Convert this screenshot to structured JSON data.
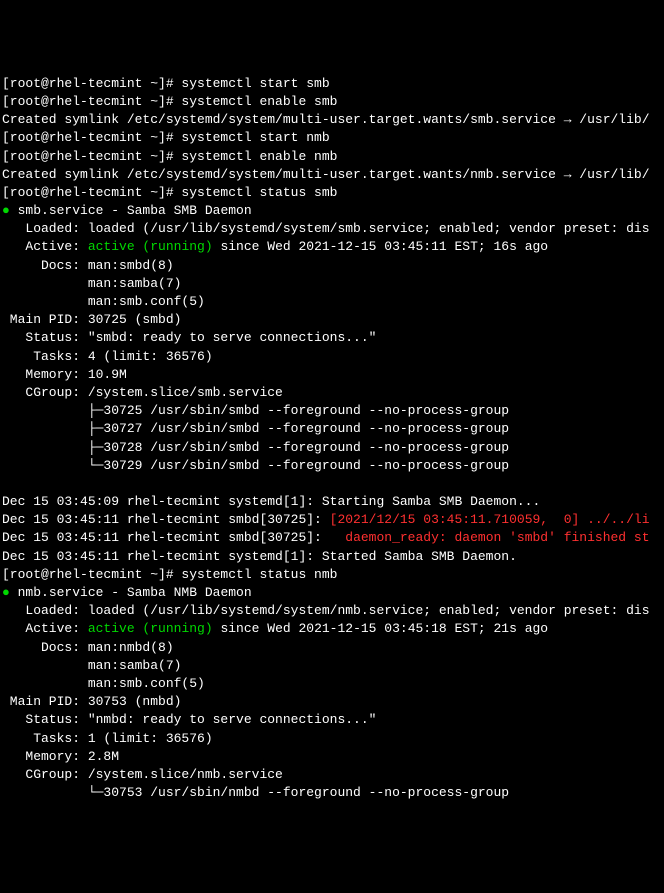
{
  "lines": [
    {
      "segments": [
        {
          "text": "[root@rhel-tecmint ~]# systemctl start smb"
        }
      ]
    },
    {
      "segments": [
        {
          "text": "[root@rhel-tecmint ~]# systemctl enable smb"
        }
      ]
    },
    {
      "segments": [
        {
          "text": "Created symlink /etc/systemd/system/multi-user.target.wants/smb.service → /usr/lib/"
        }
      ]
    },
    {
      "segments": [
        {
          "text": "[root@rhel-tecmint ~]# systemctl start nmb"
        }
      ]
    },
    {
      "segments": [
        {
          "text": "[root@rhel-tecmint ~]# systemctl enable nmb"
        }
      ]
    },
    {
      "segments": [
        {
          "text": "Created symlink /etc/systemd/system/multi-user.target.wants/nmb.service → /usr/lib/"
        }
      ]
    },
    {
      "segments": [
        {
          "text": "[root@rhel-tecmint ~]# systemctl status smb"
        }
      ]
    },
    {
      "segments": [
        {
          "text": "● ",
          "class": "bullet-green"
        },
        {
          "text": "smb.service - Samba SMB Daemon"
        }
      ]
    },
    {
      "segments": [
        {
          "text": "   Loaded: loaded (/usr/lib/systemd/system/smb.service; enabled; vendor preset: dis"
        }
      ]
    },
    {
      "segments": [
        {
          "text": "   Active: "
        },
        {
          "text": "active (running)",
          "class": "green"
        },
        {
          "text": " since Wed 2021-12-15 03:45:11 EST; 16s ago"
        }
      ]
    },
    {
      "segments": [
        {
          "text": "     Docs: man:smbd(8)"
        }
      ]
    },
    {
      "segments": [
        {
          "text": "           man:samba(7)"
        }
      ]
    },
    {
      "segments": [
        {
          "text": "           man:smb.conf(5)"
        }
      ]
    },
    {
      "segments": [
        {
          "text": " Main PID: 30725 (smbd)"
        }
      ]
    },
    {
      "segments": [
        {
          "text": "   Status: \"smbd: ready to serve connections...\""
        }
      ]
    },
    {
      "segments": [
        {
          "text": "    Tasks: 4 (limit: 36576)"
        }
      ]
    },
    {
      "segments": [
        {
          "text": "   Memory: 10.9M"
        }
      ]
    },
    {
      "segments": [
        {
          "text": "   CGroup: /system.slice/smb.service"
        }
      ]
    },
    {
      "segments": [
        {
          "text": "           ├─30725 /usr/sbin/smbd --foreground --no-process-group"
        }
      ]
    },
    {
      "segments": [
        {
          "text": "           ├─30727 /usr/sbin/smbd --foreground --no-process-group"
        }
      ]
    },
    {
      "segments": [
        {
          "text": "           ├─30728 /usr/sbin/smbd --foreground --no-process-group"
        }
      ]
    },
    {
      "segments": [
        {
          "text": "           └─30729 /usr/sbin/smbd --foreground --no-process-group"
        }
      ]
    },
    {
      "segments": [
        {
          "text": " "
        }
      ]
    },
    {
      "segments": [
        {
          "text": "Dec 15 03:45:09 rhel-tecmint systemd[1]: Starting Samba SMB Daemon..."
        }
      ]
    },
    {
      "segments": [
        {
          "text": "Dec 15 03:45:11 rhel-tecmint smbd[30725]: "
        },
        {
          "text": "[2021/12/15 03:45:11.710059,  0] ../../li",
          "class": "red"
        }
      ]
    },
    {
      "segments": [
        {
          "text": "Dec 15 03:45:11 rhel-tecmint smbd[30725]:   "
        },
        {
          "text": "daemon_ready: daemon 'smbd' finished st",
          "class": "red"
        }
      ]
    },
    {
      "segments": [
        {
          "text": "Dec 15 03:45:11 rhel-tecmint systemd[1]: Started Samba SMB Daemon."
        }
      ]
    },
    {
      "segments": [
        {
          "text": "[root@rhel-tecmint ~]# systemctl status nmb"
        }
      ]
    },
    {
      "segments": [
        {
          "text": "● ",
          "class": "bullet-green"
        },
        {
          "text": "nmb.service - Samba NMB Daemon"
        }
      ]
    },
    {
      "segments": [
        {
          "text": "   Loaded: loaded (/usr/lib/systemd/system/nmb.service; enabled; vendor preset: dis"
        }
      ]
    },
    {
      "segments": [
        {
          "text": "   Active: "
        },
        {
          "text": "active (running)",
          "class": "green"
        },
        {
          "text": " since Wed 2021-12-15 03:45:18 EST; 21s ago"
        }
      ]
    },
    {
      "segments": [
        {
          "text": "     Docs: man:nmbd(8)"
        }
      ]
    },
    {
      "segments": [
        {
          "text": "           man:samba(7)"
        }
      ]
    },
    {
      "segments": [
        {
          "text": "           man:smb.conf(5)"
        }
      ]
    },
    {
      "segments": [
        {
          "text": " Main PID: 30753 (nmbd)"
        }
      ]
    },
    {
      "segments": [
        {
          "text": "   Status: \"nmbd: ready to serve connections...\""
        }
      ]
    },
    {
      "segments": [
        {
          "text": "    Tasks: 1 (limit: 36576)"
        }
      ]
    },
    {
      "segments": [
        {
          "text": "   Memory: 2.8M"
        }
      ]
    },
    {
      "segments": [
        {
          "text": "   CGroup: /system.slice/nmb.service"
        }
      ]
    },
    {
      "segments": [
        {
          "text": "           └─30753 /usr/sbin/nmbd --foreground --no-process-group"
        }
      ]
    }
  ]
}
